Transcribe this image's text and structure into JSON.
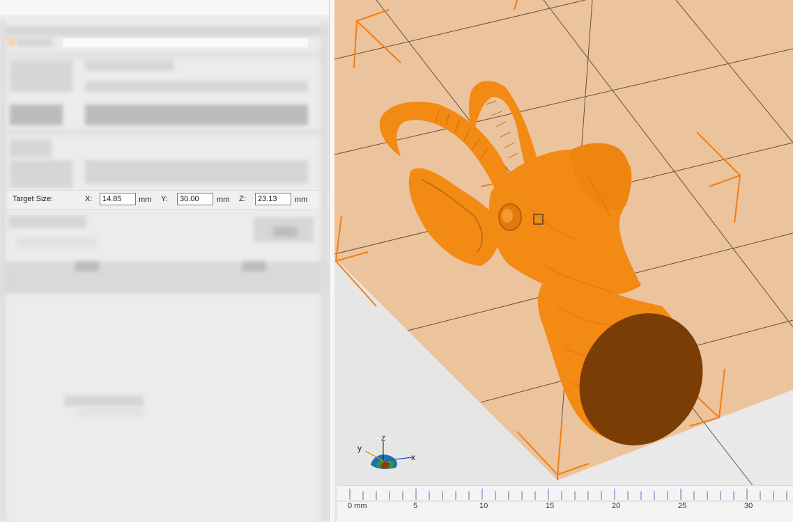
{
  "target_size": {
    "label": "Target Size:",
    "x_label": "X:",
    "x_value": "14.85",
    "y_label": "Y:",
    "y_value": "30.00",
    "z_label": "Z:",
    "z_value": "23.13",
    "unit": "mm"
  },
  "axis_gizmo": {
    "x": "x",
    "y": "y",
    "z": "z"
  },
  "ruler": {
    "labels": [
      "0 mm",
      "5",
      "10",
      "15",
      "20",
      "25",
      "30"
    ]
  },
  "colors": {
    "model": "#f28a13",
    "model_cut_face": "#7a3d05",
    "build_plate": "#ebc39c",
    "bounding_box": "#f47d12"
  },
  "icons": [
    "axis-gizmo-icon"
  ]
}
